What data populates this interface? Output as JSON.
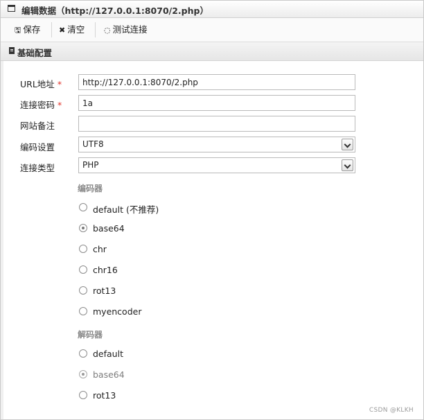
{
  "window": {
    "title": "编辑数据（http://127.0.0.1:8070/2.php）"
  },
  "toolbar": {
    "save_label": "保存",
    "clear_label": "清空",
    "test_label": "测试连接"
  },
  "section": {
    "title": "基础配置"
  },
  "form": {
    "url_label": "URL地址",
    "url_value": "http://127.0.0.1:8070/2.php",
    "password_label": "连接密码",
    "password_value": "1a",
    "note_label": "网站备注",
    "note_value": "",
    "encoding_label": "编码设置",
    "encoding_value": "UTF8",
    "type_label": "连接类型",
    "type_value": "PHP",
    "required_mark": "*"
  },
  "encoder": {
    "title": "编码器",
    "options": [
      {
        "label": "default (不推荐)",
        "checked": false
      },
      {
        "label": "base64",
        "checked": true
      },
      {
        "label": "chr",
        "checked": false
      },
      {
        "label": "chr16",
        "checked": false
      },
      {
        "label": "rot13",
        "checked": false
      },
      {
        "label": "myencoder",
        "checked": false
      }
    ]
  },
  "decoder": {
    "title": "解码器",
    "options": [
      {
        "label": "default",
        "checked": false
      },
      {
        "label": "base64",
        "checked": true
      },
      {
        "label": "rot13",
        "checked": false
      }
    ]
  },
  "watermark": "CSDN @KLKH"
}
